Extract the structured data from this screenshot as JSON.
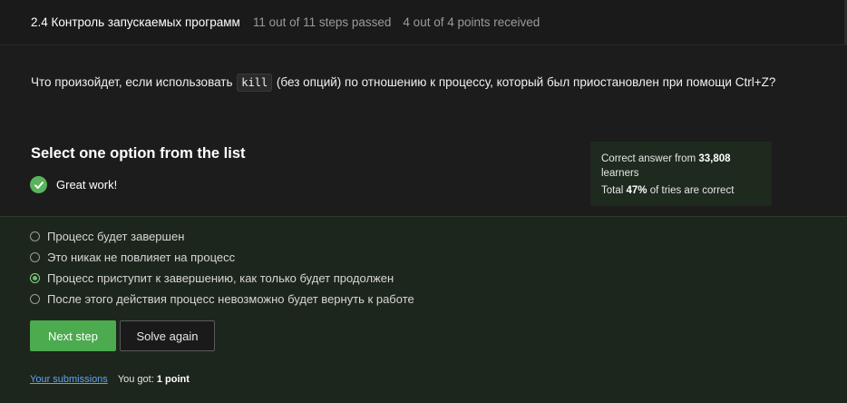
{
  "header": {
    "lesson_title": "2.4 Контроль запускаемых программ",
    "steps_passed": "11 out of 11 steps passed",
    "points_received": "4 out of 4 points  received"
  },
  "question": {
    "text_before": "Что произойдет, если использовать ",
    "code": "kill",
    "text_after": " (без опций) по отношению к процессу, который был приостановлен при помощи Ctrl+Z?"
  },
  "prompt": {
    "heading": "Select one option from the list",
    "feedback": "Great work!",
    "feedback_icon": "check-circle-icon"
  },
  "stats": {
    "line1_prefix": "Correct answer from ",
    "learners_count": "33,808",
    "line1_suffix": " learners",
    "line2_prefix": "Total ",
    "percent": "47%",
    "line2_suffix": " of tries are correct"
  },
  "options": [
    {
      "label": "Процесс будет завершен",
      "selected": false
    },
    {
      "label": "Это никак не повлияет на процесс",
      "selected": false
    },
    {
      "label": "Процесс приступит к завершению, как только будет продолжен",
      "selected": true
    },
    {
      "label": "После этого действия процесс невозможно будет вернуть к работе",
      "selected": false
    }
  ],
  "actions": {
    "next_label": "Next step",
    "solve_again_label": "Solve again"
  },
  "footer": {
    "submissions_link": "Your submissions",
    "you_got_prefix": "You got: ",
    "score": "1 point"
  },
  "colors": {
    "accent_green": "#4caa4f",
    "link_blue": "#5ea3f0",
    "panel_green": "#1d261c"
  }
}
